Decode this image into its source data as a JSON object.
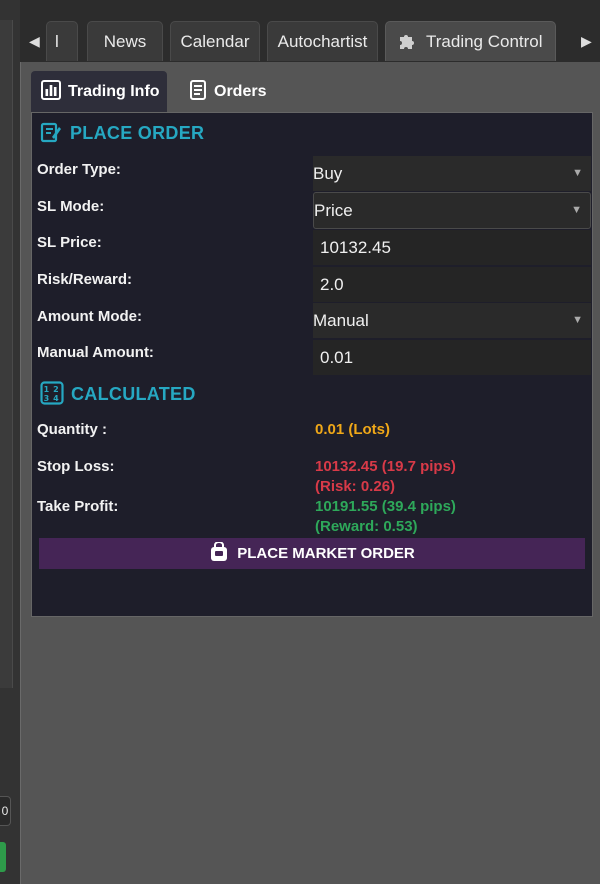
{
  "left_sidebar": {
    "badge_text": "0"
  },
  "top_tabs": {
    "partial_tab": "l",
    "tabs": [
      "News",
      "Calendar",
      "Autochartist",
      "Trading Control"
    ],
    "active_tab": "Trading Control"
  },
  "inner_tabs": [
    "Trading Info",
    "Orders"
  ],
  "place_order": {
    "title": "PLACE ORDER",
    "fields": [
      {
        "label": "Order Type:",
        "value": "Buy",
        "kind": "select"
      },
      {
        "label": "SL Mode:",
        "value": "Price",
        "kind": "select"
      },
      {
        "label": "SL Price:",
        "value": "10132.45",
        "kind": "input"
      },
      {
        "label": "Risk/Reward:",
        "value": "2.0",
        "kind": "input"
      },
      {
        "label": "Amount Mode:",
        "value": "Manual",
        "kind": "select"
      },
      {
        "label": "Manual Amount:",
        "value": "0.01",
        "kind": "input"
      }
    ]
  },
  "calculated": {
    "title": "CALCULATED",
    "quantity_label": "Quantity :",
    "quantity_value": "0.01 (Lots)",
    "stop_loss_label": "Stop Loss:",
    "stop_loss_value": "10132.45 (19.7 pips)",
    "stop_loss_risk": "(Risk: 0.26)",
    "take_profit_label": "Take Profit:",
    "take_profit_value": "10191.55 (39.4 pips)",
    "take_profit_reward": "(Reward: 0.53)"
  },
  "market_button_label": "PLACE MARKET ORDER",
  "colors": {
    "accent": "#26a8c2",
    "quantity": "#f0a818",
    "stop_loss": "#d83a48",
    "take_profit": "#2ea85a",
    "button": "#452556"
  },
  "icons": {
    "tab_left_arrow": "left-arrow-icon",
    "tab_right_arrow": "right-arrow-icon",
    "trading_control": "puzzle-icon",
    "trading_info": "bar-chart-icon",
    "orders": "document-icon",
    "place_order": "edit-icon",
    "calculated": "calculator-icon",
    "market_order": "shopping-bag-icon"
  }
}
